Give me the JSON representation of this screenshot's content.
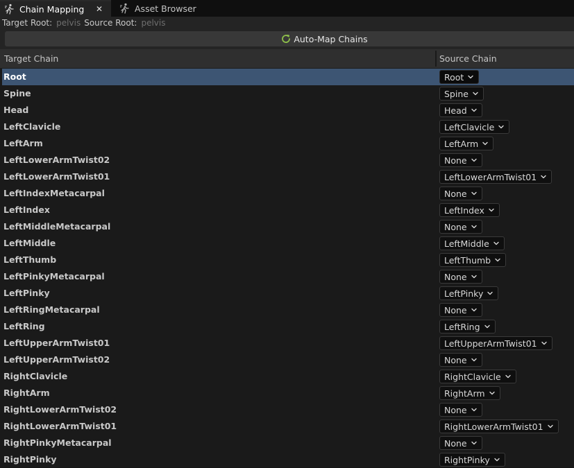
{
  "tabs": [
    {
      "label": "Chain Mapping",
      "icon": "retarget-runner-icon",
      "active": true,
      "close": "✕"
    },
    {
      "label": "Asset Browser",
      "icon": "retarget-runner-icon",
      "active": false
    }
  ],
  "roots": {
    "target_label": "Target Root:",
    "target_value": "pelvis",
    "source_label": "Source Root:",
    "source_value": "pelvis"
  },
  "automap": {
    "label": "Auto-Map Chains",
    "icon": "refresh-icon"
  },
  "columns": {
    "target": "Target Chain",
    "source": "Source Chain"
  },
  "colors": {
    "accent": "#3d5573",
    "refresh": "#8fc14a"
  },
  "rows": [
    {
      "target": "Root",
      "source": "Root",
      "selected": true
    },
    {
      "target": "Spine",
      "source": "Spine"
    },
    {
      "target": "Head",
      "source": "Head"
    },
    {
      "target": "LeftClavicle",
      "source": "LeftClavicle"
    },
    {
      "target": "LeftArm",
      "source": "LeftArm"
    },
    {
      "target": "LeftLowerArmTwist02",
      "source": "None"
    },
    {
      "target": "LeftLowerArmTwist01",
      "source": "LeftLowerArmTwist01"
    },
    {
      "target": "LeftIndexMetacarpal",
      "source": "None"
    },
    {
      "target": "LeftIndex",
      "source": "LeftIndex"
    },
    {
      "target": "LeftMiddleMetacarpal",
      "source": "None"
    },
    {
      "target": "LeftMiddle",
      "source": "LeftMiddle"
    },
    {
      "target": "LeftThumb",
      "source": "LeftThumb"
    },
    {
      "target": "LeftPinkyMetacarpal",
      "source": "None"
    },
    {
      "target": "LeftPinky",
      "source": "LeftPinky"
    },
    {
      "target": "LeftRingMetacarpal",
      "source": "None"
    },
    {
      "target": "LeftRing",
      "source": "LeftRing"
    },
    {
      "target": "LeftUpperArmTwist01",
      "source": "LeftUpperArmTwist01"
    },
    {
      "target": "LeftUpperArmTwist02",
      "source": "None"
    },
    {
      "target": "RightClavicle",
      "source": "RightClavicle"
    },
    {
      "target": "RightArm",
      "source": "RightArm"
    },
    {
      "target": "RightLowerArmTwist02",
      "source": "None"
    },
    {
      "target": "RightLowerArmTwist01",
      "source": "RightLowerArmTwist01"
    },
    {
      "target": "RightPinkyMetacarpal",
      "source": "None"
    },
    {
      "target": "RightPinky",
      "source": "RightPinky"
    }
  ]
}
